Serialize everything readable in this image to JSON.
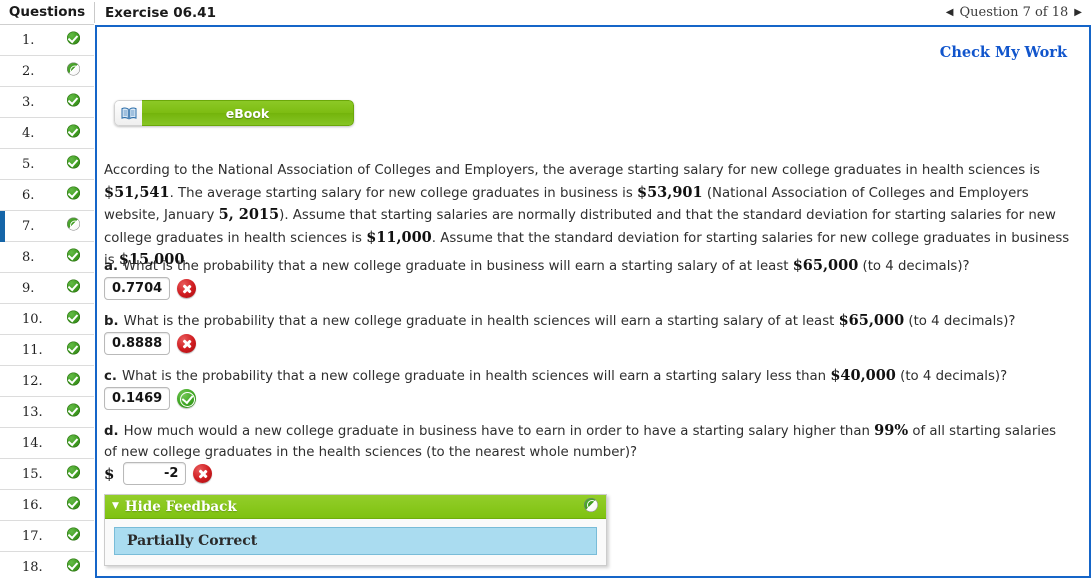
{
  "topbar": {
    "questions_label": "Questions",
    "exercise_title": "Exercise 06.41",
    "prev_arrow": "◀",
    "next_arrow": "▶",
    "question_counter": "Question 7 of 18"
  },
  "sidebar": {
    "items": [
      {
        "number": "1.",
        "status": "correct",
        "current": false
      },
      {
        "number": "2.",
        "status": "partial",
        "current": false
      },
      {
        "number": "3.",
        "status": "correct",
        "current": false
      },
      {
        "number": "4.",
        "status": "correct",
        "current": false
      },
      {
        "number": "5.",
        "status": "correct",
        "current": false
      },
      {
        "number": "6.",
        "status": "correct",
        "current": false
      },
      {
        "number": "7.",
        "status": "partial",
        "current": true
      },
      {
        "number": "8.",
        "status": "correct",
        "current": false
      },
      {
        "number": "9.",
        "status": "correct",
        "current": false
      },
      {
        "number": "10.",
        "status": "correct",
        "current": false
      },
      {
        "number": "11.",
        "status": "correct",
        "current": false
      },
      {
        "number": "12.",
        "status": "correct",
        "current": false
      },
      {
        "number": "13.",
        "status": "correct",
        "current": false
      },
      {
        "number": "14.",
        "status": "correct",
        "current": false
      },
      {
        "number": "15.",
        "status": "correct",
        "current": false
      },
      {
        "number": "16.",
        "status": "correct",
        "current": false
      },
      {
        "number": "17.",
        "status": "correct",
        "current": false
      },
      {
        "number": "18.",
        "status": "correct",
        "current": false
      }
    ]
  },
  "main": {
    "check_my_work": "Check My Work",
    "ebook_label": "eBook",
    "ebook_icon": "book-icon",
    "prompt_segments": [
      {
        "text": "According to the National Association of Colleges and Employers, the average starting salary for new college graduates in health sciences is ",
        "style": "normal"
      },
      {
        "text": "$51,541",
        "style": "math"
      },
      {
        "text": ". The average starting salary for new college graduates in business is ",
        "style": "normal"
      },
      {
        "text": "$53,901",
        "style": "math"
      },
      {
        "text": " (National Association of Colleges and Employers website, January ",
        "style": "normal"
      },
      {
        "text": "5, 2015",
        "style": "math"
      },
      {
        "text": "). Assume that starting salaries are normally distributed and that the standard deviation for starting salaries for new college graduates in health sciences is ",
        "style": "normal"
      },
      {
        "text": "$11,000",
        "style": "math"
      },
      {
        "text": ". Assume that the standard deviation for starting salaries for new college graduates in business is ",
        "style": "normal"
      },
      {
        "text": "$15,000",
        "style": "math"
      },
      {
        "text": ".",
        "style": "normal"
      }
    ],
    "parts": [
      {
        "letter": "a.",
        "segments": [
          {
            "text": "What is the probability that a new college graduate in business will earn a starting salary of at least ",
            "style": "normal"
          },
          {
            "text": "$65,000",
            "style": "math"
          },
          {
            "text": " (to 4 decimals)?",
            "style": "normal"
          }
        ],
        "value": "0.7704",
        "prefix": "",
        "status": "incorrect"
      },
      {
        "letter": "b.",
        "segments": [
          {
            "text": "What is the probability that a new college graduate in health sciences will earn a starting salary of at least ",
            "style": "normal"
          },
          {
            "text": "$65,000",
            "style": "math"
          },
          {
            "text": " (to 4 decimals)?",
            "style": "normal"
          }
        ],
        "value": "0.8888",
        "prefix": "",
        "status": "incorrect"
      },
      {
        "letter": "c.",
        "segments": [
          {
            "text": "What is the probability that a new college graduate in health sciences will earn a starting salary less than ",
            "style": "normal"
          },
          {
            "text": "$40,000",
            "style": "math"
          },
          {
            "text": " (to 4 decimals)?",
            "style": "normal"
          }
        ],
        "value": "0.1469",
        "prefix": "",
        "status": "correct"
      },
      {
        "letter": "d.",
        "segments": [
          {
            "text": "How much would a new college graduate in business have to earn in order to have a starting salary higher than ",
            "style": "normal"
          },
          {
            "text": "99%",
            "style": "math"
          },
          {
            "text": " of all starting salaries of new college graduates in the health sciences (to the nearest whole number)?",
            "style": "normal"
          }
        ],
        "value": "-2",
        "prefix": "$",
        "status": "incorrect"
      }
    ],
    "feedback": {
      "caret": "▼",
      "title": "Hide Feedback",
      "status_icon": "partial-circle-icon",
      "banner_text": "Partially Correct"
    }
  }
}
